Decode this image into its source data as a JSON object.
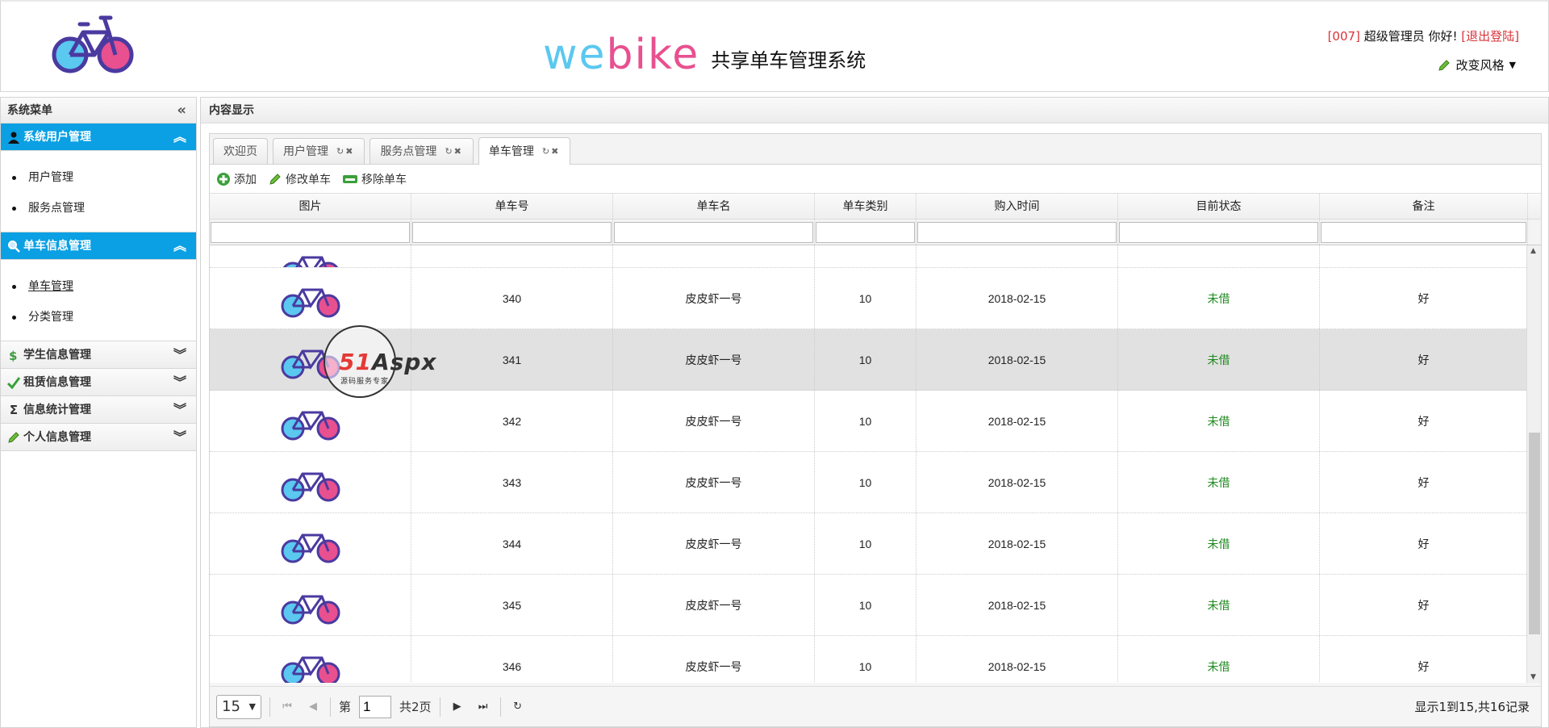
{
  "header": {
    "brand_web": "we",
    "brand_bike": "bike",
    "brand_subtitle": "共享单车管理系统",
    "user_code": "[007]",
    "user_greeting": "超级管理员 你好!",
    "logout_label": "[退出登陆]",
    "change_style_label": "改变风格"
  },
  "sidebar": {
    "title": "系统菜单",
    "groups": [
      {
        "label": "系统用户管理",
        "items": [
          "用户管理",
          "服务点管理"
        ]
      },
      {
        "label": "单车信息管理",
        "items": [
          "单车管理",
          "分类管理"
        ]
      },
      {
        "label": "学生信息管理"
      },
      {
        "label": "租赁信息管理"
      },
      {
        "label": "信息统计管理"
      },
      {
        "label": "个人信息管理"
      }
    ]
  },
  "content": {
    "title": "内容显示",
    "tabs": [
      "欢迎页",
      "用户管理",
      "服务点管理",
      "单车管理"
    ],
    "toolbar": {
      "add": "添加",
      "edit": "修改单车",
      "remove": "移除单车"
    },
    "columns": [
      "图片",
      "单车号",
      "单车名",
      "单车类别",
      "购入时间",
      "目前状态",
      "备注"
    ],
    "rows": [
      {
        "id": "340",
        "name": "皮皮虾一号",
        "category": "10",
        "date": "2018-02-15",
        "status": "未借",
        "note": "好"
      },
      {
        "id": "341",
        "name": "皮皮虾一号",
        "category": "10",
        "date": "2018-02-15",
        "status": "未借",
        "note": "好"
      },
      {
        "id": "342",
        "name": "皮皮虾一号",
        "category": "10",
        "date": "2018-02-15",
        "status": "未借",
        "note": "好"
      },
      {
        "id": "343",
        "name": "皮皮虾一号",
        "category": "10",
        "date": "2018-02-15",
        "status": "未借",
        "note": "好"
      },
      {
        "id": "344",
        "name": "皮皮虾一号",
        "category": "10",
        "date": "2018-02-15",
        "status": "未借",
        "note": "好"
      },
      {
        "id": "345",
        "name": "皮皮虾一号",
        "category": "10",
        "date": "2018-02-15",
        "status": "未借",
        "note": "好"
      },
      {
        "id": "346",
        "name": "皮皮虾一号",
        "category": "10",
        "date": "2018-02-15",
        "status": "未借",
        "note": "好"
      }
    ],
    "pager": {
      "page_size": "15",
      "page_prefix": "第",
      "current_page": "1",
      "total_pages": "共2页",
      "info": "显示1到15,共16记录"
    }
  },
  "watermark": {
    "brand_red": "51",
    "brand": "Aspx",
    "tagline": "源码服务专家"
  },
  "colors": {
    "accent": "#0aa0e3",
    "status_green": "#1f8a1f",
    "logout_red": "#d9343a"
  }
}
